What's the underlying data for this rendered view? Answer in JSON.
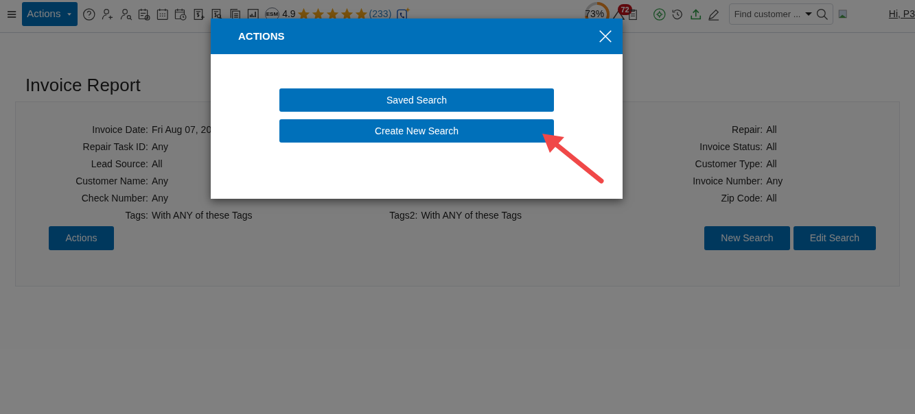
{
  "toolbar": {
    "actions_button": "Actions",
    "esm_badge": "ESM",
    "rating": "4.9",
    "stars": 5,
    "review_count": "(233)",
    "progress": {
      "reading": "73%",
      "level": 0.73
    },
    "notification_count": "72",
    "search": {
      "placeholder": "Find customer ..."
    },
    "user_link": "Hi, P3"
  },
  "page": {
    "title": "Invoice Report",
    "filter_columns": [
      [
        {
          "label": "Invoice Date:",
          "value": "Fri Aug 07, 20"
        },
        {
          "label": "Repair Task ID:",
          "value": "Any"
        },
        {
          "label": "Lead Source:",
          "value": "All"
        },
        {
          "label": "Customer Name:",
          "value": "Any"
        },
        {
          "label": "Check Number:",
          "value": "Any"
        },
        {
          "label": "Tags:",
          "value": "With ANY of these Tags"
        }
      ],
      [
        {
          "label": "Tags2:",
          "value": "With ANY of these Tags"
        }
      ],
      [
        {
          "label": "Repair:",
          "value": "All"
        },
        {
          "label": "Invoice Status:",
          "value": "All"
        },
        {
          "label": "Customer Type:",
          "value": "All"
        },
        {
          "label": "Invoice Number:",
          "value": "Any"
        },
        {
          "label": "Zip Code:",
          "value": "All"
        }
      ]
    ],
    "left_buttons": [
      "Actions"
    ],
    "right_buttons": [
      "New Search",
      "Edit Search"
    ]
  },
  "modal": {
    "title": "ACTIONS",
    "buttons": [
      "Saved Search",
      "Create New Search"
    ]
  }
}
